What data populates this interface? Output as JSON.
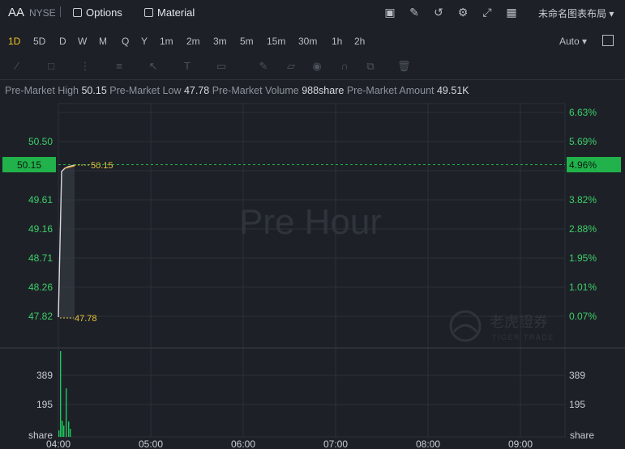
{
  "header": {
    "ticker": "AA",
    "exchange": "NYSE",
    "options_label": "Options",
    "material_label": "Material",
    "layout_label": "未命名图表布局",
    "tool_icons": [
      "chart-icon",
      "edit-icon",
      "refresh-icon",
      "gear-icon",
      "expand-icon",
      "grid-icon"
    ]
  },
  "timeframes": {
    "items": [
      "1D",
      "5D",
      "D",
      "W",
      "M",
      "Q",
      "Y",
      "1m",
      "2m",
      "3m",
      "5m",
      "15m",
      "30m",
      "1h",
      "2h"
    ],
    "active": "1D",
    "scale_label": "Auto"
  },
  "info": {
    "high_label": "Pre-Market High",
    "high_value": "50.15",
    "low_label": "Pre-Market Low",
    "low_value": "47.78",
    "volume_label": "Pre-Market Volume",
    "volume_value": "988share",
    "amount_label": "Pre-Market Amount",
    "amount_value": "49.51K"
  },
  "chart": {
    "watermark": "Pre Hour",
    "brand_cn": "老虎證券",
    "brand_en": "TIGER TRADE",
    "current_price_label": "50.15",
    "current_pct_label": "4.96%",
    "high_marker": "50.15",
    "low_marker": "47.78",
    "left_ticks": [
      "50.50",
      "49.61",
      "49.16",
      "48.71",
      "48.26",
      "47.82"
    ],
    "right_ticks": [
      "6.63%",
      "5.69%",
      "3.82%",
      "2.88%",
      "1.95%",
      "1.01%",
      "0.07%"
    ],
    "vol_ticks": [
      "389",
      "195"
    ],
    "vol_unit": "share",
    "time_ticks": [
      "04:00",
      "05:00",
      "06:00",
      "07:00",
      "08:00",
      "09:00"
    ],
    "colors": {
      "up": "#22c55e",
      "label_bg": "#21b24b",
      "marker": "#e8c13a",
      "grid": "#2b3037"
    }
  }
}
